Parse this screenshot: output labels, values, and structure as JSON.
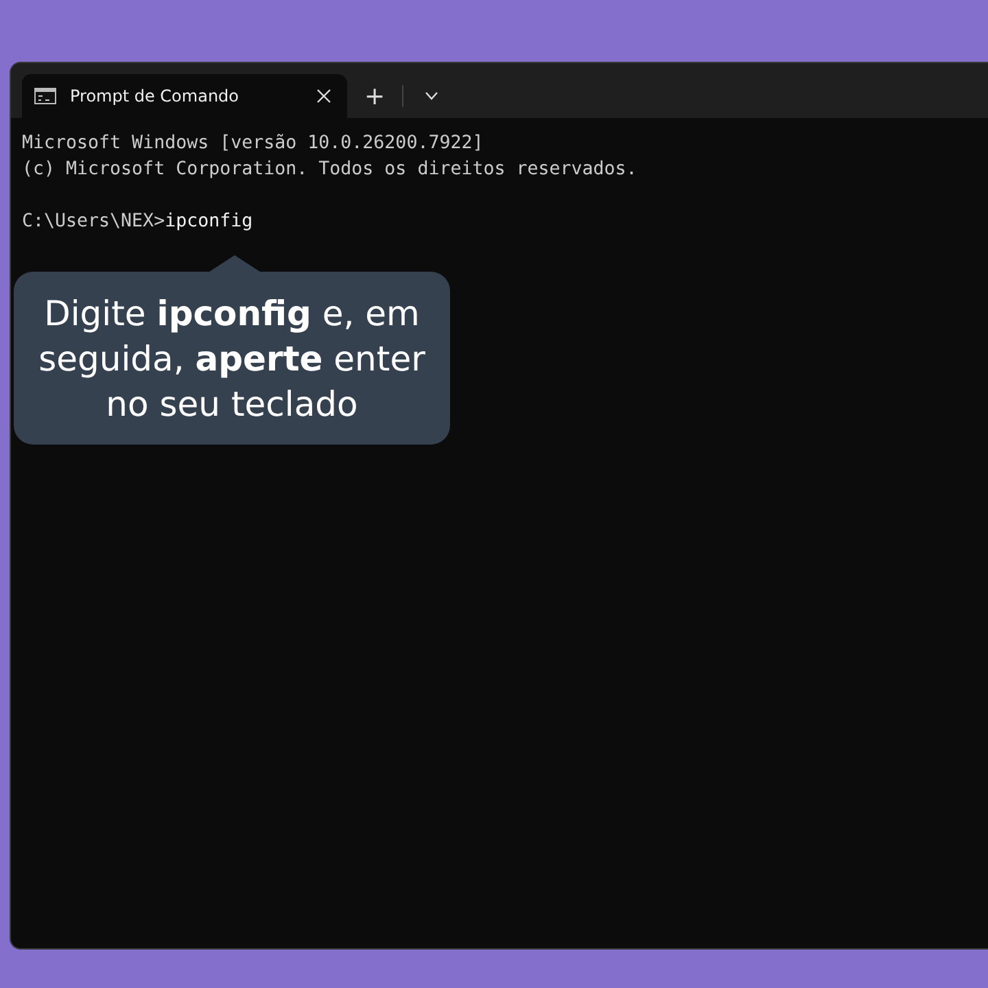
{
  "window": {
    "tabs": [
      {
        "title": "Prompt de Comando",
        "selected": true
      }
    ],
    "new_tab": "+"
  },
  "terminal": {
    "lines": [
      "Microsoft Windows [versão 10.0.26200.7922]",
      "(c) Microsoft Corporation. Todos os direitos reservados."
    ],
    "prompt": "C:\\Users\\NEX>",
    "command": "ipconfig"
  },
  "tooltip": "Digite **ipconfig** e, em seguida, **aperte** enter no seu teclado"
}
